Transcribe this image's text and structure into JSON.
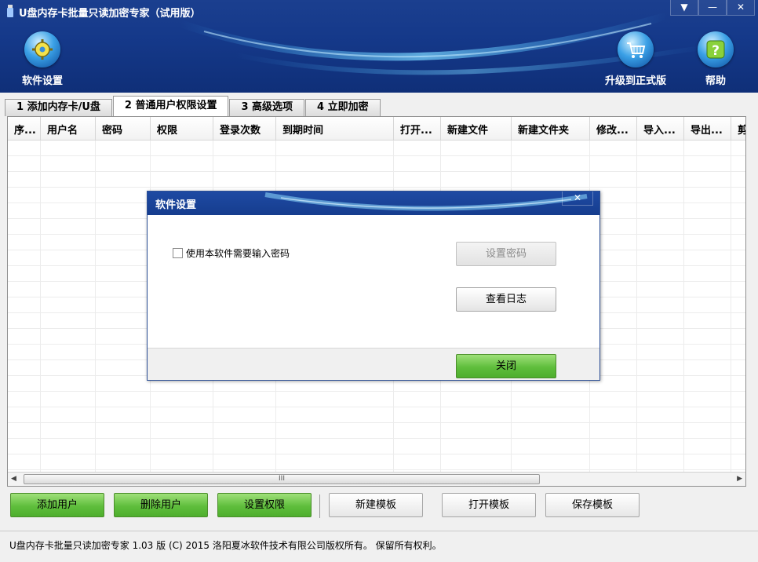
{
  "window": {
    "title": "U盘内存卡批量只读加密专家（试用版）",
    "controls": [
      "▼",
      "—",
      "✕"
    ]
  },
  "toolbar": {
    "settings_label": "软件设置",
    "upgrade_label": "升级到正式版",
    "help_label": "帮助"
  },
  "tabs": [
    {
      "label": "1 添加内存卡/U盘",
      "active": false
    },
    {
      "label": "2 普通用户权限设置",
      "active": true
    },
    {
      "label": "3 高级选项",
      "active": false
    },
    {
      "label": "4 立即加密",
      "active": false
    }
  ],
  "grid": {
    "columns": [
      "序...",
      "用户名",
      "密码",
      "权限",
      "登录次数",
      "到期时间",
      "打开...",
      "新建文件",
      "新建文件夹",
      "修改...",
      "导入...",
      "导出...",
      "剪"
    ],
    "scroll_thumb": "III"
  },
  "buttons": {
    "add_user": "添加用户",
    "delete_user": "删除用户",
    "set_permission": "设置权限",
    "new_template": "新建模板",
    "open_template": "打开模板",
    "save_template": "保存模板"
  },
  "status": {
    "text": "U盘内存卡批量只读加密专家 1.03 版  (C) 2015 洛阳夏冰软件技术有限公司版权所有。 保留所有权利。"
  },
  "dialog": {
    "title": "软件设置",
    "close_glyph": "✕",
    "checkbox_label": "使用本软件需要输入密码",
    "set_password": "设置密码",
    "view_log": "查看日志",
    "close_button": "关闭"
  },
  "colors": {
    "header_blue": "#15398a",
    "green_button": "#5fbe3c",
    "grid_line": "#ececec"
  }
}
